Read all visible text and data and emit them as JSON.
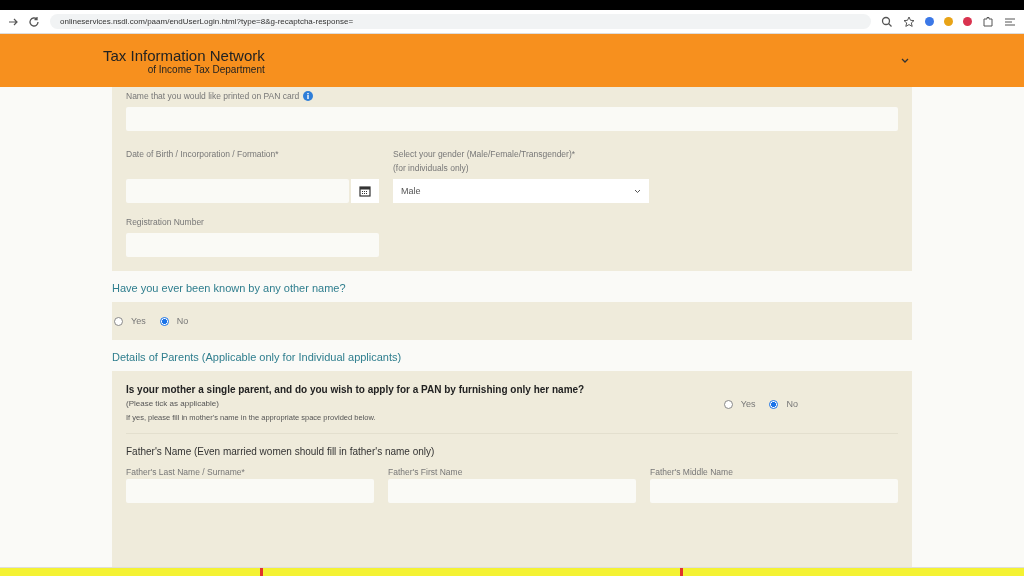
{
  "browser": {
    "url": "onlineservices.nsdl.com/paam/endUserLogin.html?type=8&g-recaptcha-response="
  },
  "header": {
    "title": "Tax Information Network",
    "subtitle": "of Income Tax Department"
  },
  "personal": {
    "name_label": "Name that you would like printed on PAN card",
    "dob_label": "Date of Birth / Incorporation / Formation*",
    "gender_label": "Select your gender (Male/Female/Transgender)*",
    "gender_note": "(for individuals only)",
    "gender_value": "Male",
    "registration_label": "Registration Number"
  },
  "other_name": {
    "heading": "Have you ever been known by any other name?",
    "options": [
      {
        "label": "Yes",
        "selected": false
      },
      {
        "label": "No",
        "selected": true
      }
    ]
  },
  "parents": {
    "heading": "Details of Parents (Applicable only for Individual applicants)",
    "question": "Is your mother a single parent, and do you wish to apply for a PAN by furnishing only her name?",
    "note1": "(Please tick as applicable)",
    "note2": "If yes, please fill in mother's name in the appropriate space provided below.",
    "options": [
      {
        "label": "Yes",
        "selected": false
      },
      {
        "label": "No",
        "selected": true
      }
    ],
    "father_heading": "Father's Name (Even married women should fill in father's name only)",
    "fields": [
      "Father's Last Name / Surname*",
      "Father's First Name",
      "Father's Middle Name"
    ]
  }
}
